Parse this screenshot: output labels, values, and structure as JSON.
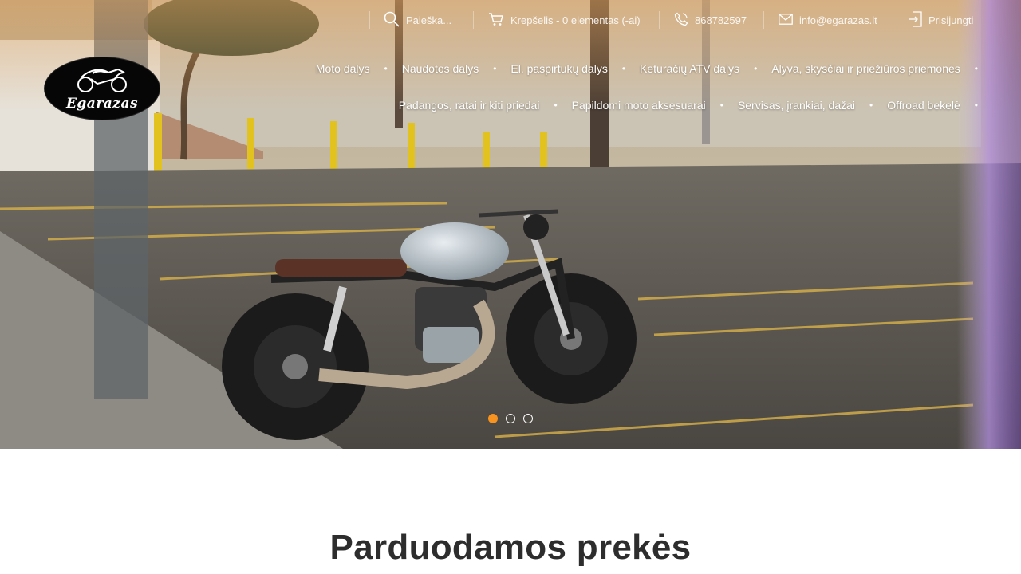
{
  "topbar": {
    "search_label": "Paieška...",
    "cart_label": "Krepšelis - 0 elementas (-ai)",
    "phone": "868782597",
    "email": "info@egarazas.lt",
    "login_label": "Prisijungti"
  },
  "logo": {
    "text": "Egarazas"
  },
  "nav": {
    "row1": [
      "Moto dalys",
      "Naudotos dalys",
      "El. paspirtukų dalys",
      "Keturačių ATV dalys",
      "Alyva, skysčiai ir priežiūros priemonės"
    ],
    "row2": [
      "Padangos, ratai ir kiti priedai",
      "Papildomi moto aksesuarai",
      "Servisas, įrankiai, dažai",
      "Offroad bekelė"
    ]
  },
  "slider": {
    "count": 3,
    "active": 1,
    "active_color": "#f7931e"
  },
  "section": {
    "title": "Parduodamos prekės"
  },
  "icons": [
    "search-icon",
    "cart-icon",
    "phone-icon",
    "mail-icon",
    "login-icon",
    "motorcycle-logo-icon"
  ]
}
